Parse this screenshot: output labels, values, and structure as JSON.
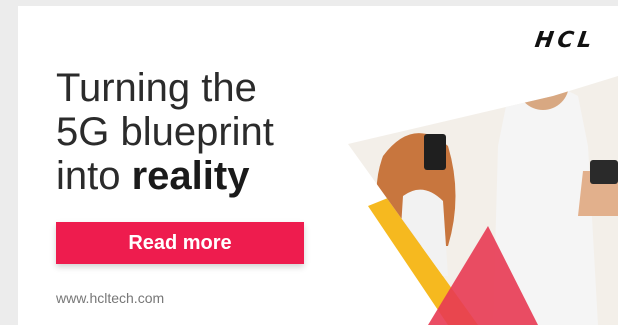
{
  "brand": {
    "logo_text": "HCL"
  },
  "headline": {
    "line1": "Turning the",
    "line2": "5G blueprint",
    "line3_prefix": "into ",
    "line3_emphasis": "reality"
  },
  "cta": {
    "label": "Read more"
  },
  "footer": {
    "url": "www.hcltech.com"
  },
  "colors": {
    "accent": "#ee1c4e",
    "yellow": "#f6b91f",
    "red_shape": "#e83a53"
  }
}
